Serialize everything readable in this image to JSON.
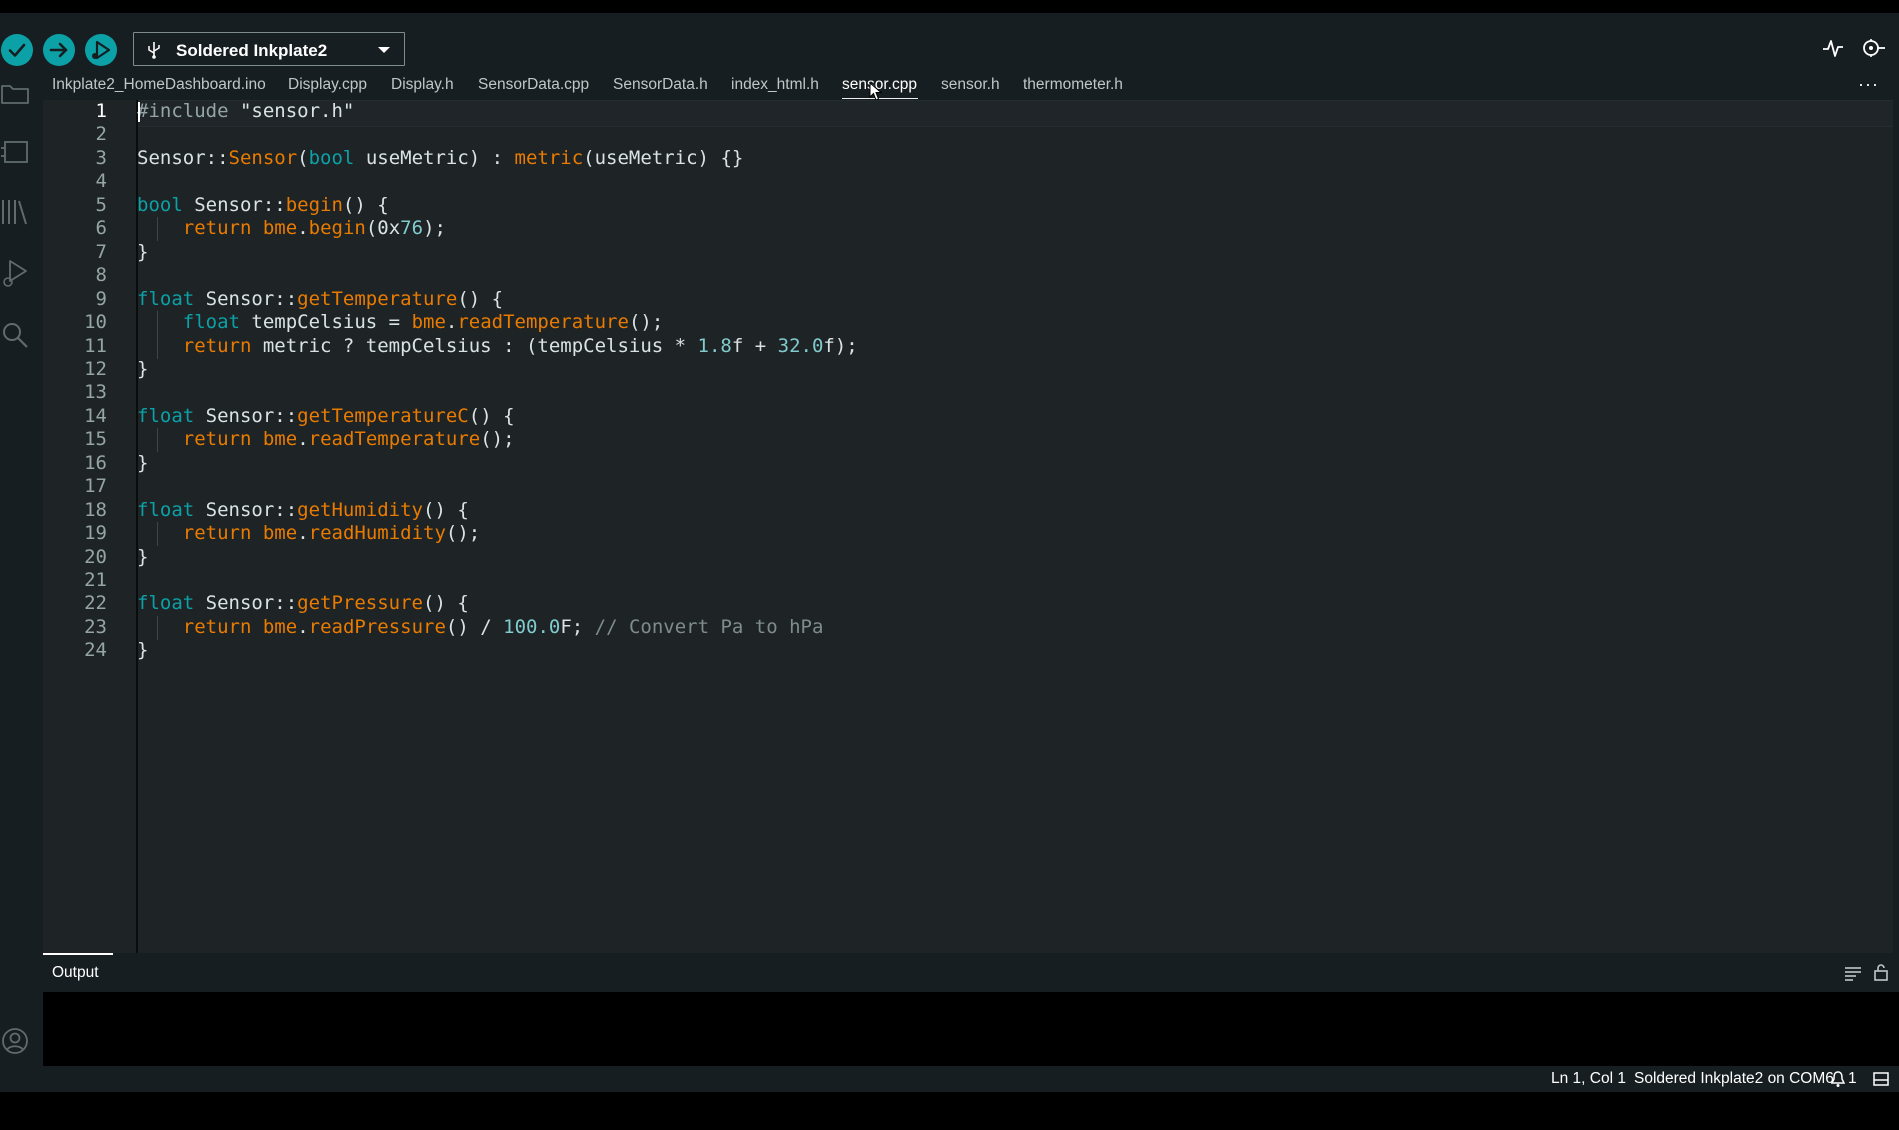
{
  "toolbar": {
    "board_name": "Soldered Inkplate2"
  },
  "tabs": [
    {
      "label": "Inkplate2_HomeDashboard.ino",
      "active": false
    },
    {
      "label": "Display.cpp",
      "active": false
    },
    {
      "label": "Display.h",
      "active": false
    },
    {
      "label": "SensorData.cpp",
      "active": false
    },
    {
      "label": "SensorData.h",
      "active": false
    },
    {
      "label": "index_html.h",
      "active": false
    },
    {
      "label": "sensor.cpp",
      "active": true
    },
    {
      "label": "sensor.h",
      "active": false
    },
    {
      "label": "thermometer.h",
      "active": false
    }
  ],
  "tabs_more": "···",
  "editor": {
    "current_line": 1,
    "lines": [
      [
        [
          "p",
          "#include"
        ],
        [
          "d",
          " "
        ],
        [
          "s",
          "\"sensor.h\""
        ]
      ],
      [],
      [
        [
          "d",
          "Sensor::"
        ],
        [
          "f",
          "Sensor"
        ],
        [
          "d",
          "("
        ],
        [
          "k",
          "bool"
        ],
        [
          "d",
          " useMetric) : "
        ],
        [
          "f",
          "metric"
        ],
        [
          "d",
          "(useMetric) {}"
        ]
      ],
      [],
      [
        [
          "k",
          "bool"
        ],
        [
          "d",
          " Sensor::"
        ],
        [
          "f",
          "begin"
        ],
        [
          "d",
          "() {"
        ]
      ],
      [
        [
          "d",
          "    "
        ],
        [
          "f",
          "return"
        ],
        [
          "d",
          " "
        ],
        [
          "f",
          "bme"
        ],
        [
          "d",
          "."
        ],
        [
          "f",
          "begin"
        ],
        [
          "d",
          "(0x"
        ],
        [
          "n",
          "76"
        ],
        [
          "d",
          ");"
        ]
      ],
      [
        [
          "d",
          "}"
        ]
      ],
      [],
      [
        [
          "k",
          "float"
        ],
        [
          "d",
          " Sensor::"
        ],
        [
          "f",
          "getTemperature"
        ],
        [
          "d",
          "() {"
        ]
      ],
      [
        [
          "d",
          "    "
        ],
        [
          "k",
          "float"
        ],
        [
          "d",
          " tempCelsius = "
        ],
        [
          "f",
          "bme"
        ],
        [
          "d",
          "."
        ],
        [
          "f",
          "readTemperature"
        ],
        [
          "d",
          "();"
        ]
      ],
      [
        [
          "d",
          "    "
        ],
        [
          "f",
          "return"
        ],
        [
          "d",
          " metric ? tempCelsius : (tempCelsius * "
        ],
        [
          "n",
          "1.8"
        ],
        [
          "d",
          "f + "
        ],
        [
          "n",
          "32.0"
        ],
        [
          "d",
          "f);"
        ]
      ],
      [
        [
          "d",
          "}"
        ]
      ],
      [],
      [
        [
          "k",
          "float"
        ],
        [
          "d",
          " Sensor::"
        ],
        [
          "f",
          "getTemperatureC"
        ],
        [
          "d",
          "() {"
        ]
      ],
      [
        [
          "d",
          "    "
        ],
        [
          "f",
          "return"
        ],
        [
          "d",
          " "
        ],
        [
          "f",
          "bme"
        ],
        [
          "d",
          "."
        ],
        [
          "f",
          "readTemperature"
        ],
        [
          "d",
          "();"
        ]
      ],
      [
        [
          "d",
          "}"
        ]
      ],
      [],
      [
        [
          "k",
          "float"
        ],
        [
          "d",
          " Sensor::"
        ],
        [
          "f",
          "getHumidity"
        ],
        [
          "d",
          "() {"
        ]
      ],
      [
        [
          "d",
          "    "
        ],
        [
          "f",
          "return"
        ],
        [
          "d",
          " "
        ],
        [
          "f",
          "bme"
        ],
        [
          "d",
          "."
        ],
        [
          "f",
          "readHumidity"
        ],
        [
          "d",
          "();"
        ]
      ],
      [
        [
          "d",
          "}"
        ]
      ],
      [],
      [
        [
          "k",
          "float"
        ],
        [
          "d",
          " Sensor::"
        ],
        [
          "f",
          "getPressure"
        ],
        [
          "d",
          "() {"
        ]
      ],
      [
        [
          "d",
          "    "
        ],
        [
          "f",
          "return"
        ],
        [
          "d",
          " "
        ],
        [
          "f",
          "bme"
        ],
        [
          "d",
          "."
        ],
        [
          "f",
          "readPressure"
        ],
        [
          "d",
          "() / "
        ],
        [
          "n",
          "100.0"
        ],
        [
          "d",
          "F; "
        ],
        [
          "c",
          "// Convert Pa to hPa"
        ]
      ],
      [
        [
          "d",
          "}"
        ]
      ]
    ],
    "guides": [
      6,
      10,
      11,
      15,
      19,
      23
    ]
  },
  "panel": {
    "tab_label": "Output"
  },
  "status": {
    "position": "Ln 1, Col 1",
    "board_port": "Soldered Inkplate2 on COM6",
    "notifications": "1"
  },
  "colors": {
    "accent": "#0ca1a6",
    "function": "#e97b00",
    "number": "#7fcbcd",
    "editor_bg": "#1e2326",
    "chrome_bg": "#171e21"
  }
}
